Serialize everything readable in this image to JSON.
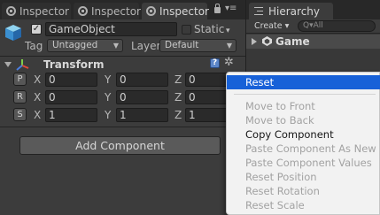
{
  "inspector": {
    "tabs": [
      {
        "label": "Inspector",
        "active": false
      },
      {
        "label": "Inspector",
        "active": false
      },
      {
        "label": "Inspector",
        "active": true
      }
    ],
    "menu_glyph": "▾≡",
    "gameobject": {
      "active_checked": true,
      "name": "GameObject",
      "static_label": "Static",
      "static_arrow": "▾",
      "tag_label": "Tag",
      "tag_value": "Untagged",
      "layer_label": "Layer",
      "layer_value": "Default"
    },
    "transform": {
      "title": "Transform",
      "help_glyph": "?",
      "gear_glyph": "✲",
      "rows": [
        {
          "button": "P",
          "x": "0",
          "y": "0",
          "z": "0"
        },
        {
          "button": "R",
          "x": "0",
          "y": "0",
          "z": "0"
        },
        {
          "button": "S",
          "x": "1",
          "y": "1",
          "z": "1"
        }
      ],
      "axis_labels": {
        "x": "X",
        "y": "Y",
        "z": "Z"
      }
    },
    "add_component_label": "Add Component"
  },
  "hierarchy": {
    "tab_label": "Hierarchy",
    "create_label": "Create ▾",
    "search_placeholder": "Q▾All",
    "scene_name": "Game"
  },
  "context_menu": {
    "highlight_color": "#1761d8",
    "items": [
      {
        "label": "Reset",
        "enabled": true,
        "highlighted": true
      },
      {
        "label": "Move to Front",
        "enabled": false
      },
      {
        "label": "Move to Back",
        "enabled": false
      },
      {
        "label": "Copy Component",
        "enabled": true
      },
      {
        "label": "Paste Component As New",
        "enabled": false
      },
      {
        "label": "Paste Component Values",
        "enabled": false
      },
      {
        "label": "Reset Position",
        "enabled": false
      },
      {
        "label": "Reset Rotation",
        "enabled": false
      },
      {
        "label": "Reset Scale",
        "enabled": false
      }
    ]
  }
}
